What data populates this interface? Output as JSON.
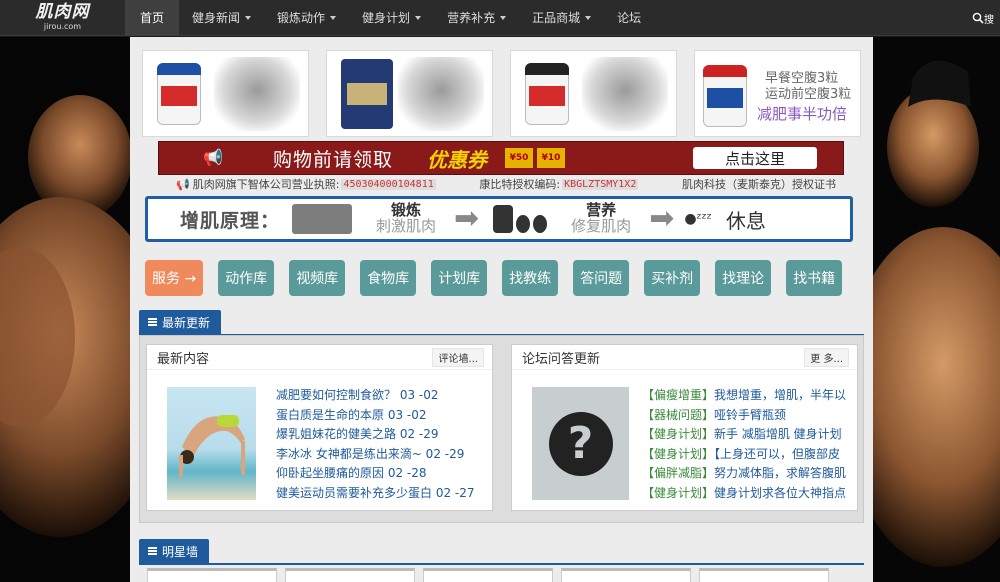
{
  "logo": {
    "title": "肌肉网",
    "domain": "jirou.com"
  },
  "nav": {
    "items": [
      {
        "label": "首页",
        "active": true,
        "dropdown": false
      },
      {
        "label": "健身新闻",
        "dropdown": true
      },
      {
        "label": "锻炼动作",
        "dropdown": true
      },
      {
        "label": "健身计划",
        "dropdown": true
      },
      {
        "label": "营养补充",
        "dropdown": true
      },
      {
        "label": "正品商城",
        "dropdown": true
      },
      {
        "label": "论坛",
        "dropdown": false
      }
    ],
    "search_label": "搜"
  },
  "products": {
    "breakfast_line1": "早餐空腹3粒",
    "breakfast_line2": "运动前空腹3粒",
    "breakfast_line3": "减肥事半功倍"
  },
  "coupon": {
    "text": "购物前请领取",
    "tag": "优惠券",
    "env1": "¥50",
    "env2": "¥10",
    "button": "点击这里"
  },
  "licence": {
    "part1": "肌肉网旗下智体公司营业执照:",
    "code1": "450304000104811",
    "part2": "康比特授权编码:",
    "code2": "KBGLZTSMY1X2",
    "part3": "肌肉科技（麦斯泰克）授权证书"
  },
  "principle": {
    "title": "增肌原理：",
    "step1_a": "锻炼",
    "step1_b": "刺激肌肉",
    "step2_a": "营养",
    "step2_b": "修复肌肉",
    "step3": "休息"
  },
  "tags": {
    "service": "服务 →",
    "items": [
      "动作库",
      "视频库",
      "食物库",
      "计划库",
      "找教练",
      "答问题",
      "买补剂",
      "找理论",
      "找书籍"
    ]
  },
  "latest": {
    "section_title": "最新更新",
    "news": {
      "title": "最新内容",
      "more": "评论墙...",
      "items": [
        "减肥要如何控制食欲？ 03 -02",
        "蛋白质是生命的本原 03 -02",
        "爆乳姐妹花的健美之路 02 -29",
        "李冰冰 女神都是练出来滴~ 02 -29",
        "仰卧起坐腰痛的原因 02 -28",
        "健美运动员需要补充多少蛋白 02 -27"
      ]
    },
    "forum": {
      "title": "论坛问答更新",
      "more": "更 多...",
      "items": [
        {
          "cat": "【偏瘦增重】",
          "text": "我想增重，增肌，半年以"
        },
        {
          "cat": "【器械问题】",
          "text": "哑铃手臂瓶颈"
        },
        {
          "cat": "【健身计划】",
          "text": "新手 减脂增肌 健身计划"
        },
        {
          "cat": "【健身计划】",
          "text": "【上身还可以，但腹部皮"
        },
        {
          "cat": "【偏胖减脂】",
          "text": "努力减体脂，求解答腹肌"
        },
        {
          "cat": "【健身计划】",
          "text": "健身计划求各位大神指点"
        }
      ]
    }
  },
  "stars": {
    "section_title": "明星墙"
  }
}
